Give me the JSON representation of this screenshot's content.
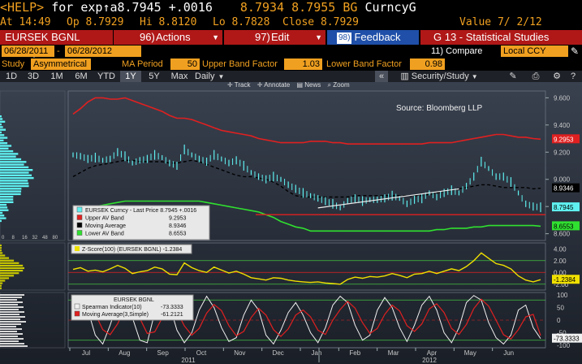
{
  "command": {
    "prompt": "<HELP>",
    "text": " for exp",
    "arrow": "↑",
    "ticker_text": "a8.7945 +.0016",
    "mid": "8.7934 8.7955 BG",
    "ticker": "CurncyG"
  },
  "quote": {
    "at": "At 14:49",
    "op": "Op 8.7929",
    "hi": "Hi 8.8120",
    "lo": "Lo 8.7828",
    "close": "Close 8.7929",
    "value": "Value  7/ 2/12"
  },
  "menu": {
    "security": "EURSEK BGNL Curncy",
    "actions_num": "96)",
    "actions": "Actions",
    "edit_num": "97)",
    "edit": "Edit",
    "feedback_num": "98)",
    "feedback": "Feedback",
    "title": "G 13 - Statistical Studies"
  },
  "range": {
    "start": "06/28/2011",
    "sep": "-",
    "end": "06/28/2012",
    "compare": "11) Compare",
    "currency": "Local CCY"
  },
  "study": {
    "label": "Study",
    "value": "Asymmetrical",
    "ma_label": "MA Period",
    "ma_value": "50",
    "upper_label": "Upper Band Factor",
    "upper_value": "1.03",
    "lower_label": "Lower Band Factor",
    "lower_value": "0.98"
  },
  "tabs": [
    "1D",
    "3D",
    "1M",
    "6M",
    "YTD",
    "1Y",
    "5Y",
    "Max",
    "Daily"
  ],
  "selected_tab": "1Y",
  "toolbar": {
    "collapse": "«",
    "security_study": "Security/Study",
    "track": "Track",
    "annotate": "Annotate",
    "news": "News",
    "zoom": "Zoom"
  },
  "chart_data": [
    {
      "type": "line",
      "title": "",
      "source": "Source: Bloomberg LLP",
      "x_labels": [
        "Jul",
        "Aug",
        "Sep",
        "Oct",
        "Nov",
        "Dec",
        "Jan",
        "Feb",
        "Mar",
        "Apr",
        "May",
        "Jun"
      ],
      "year_labels": [
        "2011",
        "2012"
      ],
      "y_ticks": [
        "9.600",
        "9.400",
        "9.200",
        "9.000",
        "8.800",
        "8.600"
      ],
      "ylim": [
        8.55,
        9.65
      ],
      "last_values": {
        "upper": "9.2953",
        "ma": "8.9346",
        "price": "8.7945",
        "lower": "8.6553"
      },
      "legend": [
        {
          "name": "EURSEK Curncy - Last Price 8.7945  +.0016",
          "color": "#5ff0f0"
        },
        {
          "name": "Upper AV Band",
          "value": "9.2953",
          "color": "#e02020"
        },
        {
          "name": "Moving Average",
          "value": "8.9346",
          "color": "#000000"
        },
        {
          "name": "Lower AV Band",
          "value": "8.6553",
          "color": "#30e030"
        }
      ],
      "histogram_ticks": [
        "0",
        "8",
        "16",
        "32",
        "48",
        "80"
      ],
      "series": [
        {
          "name": "EURSEK Curncy - Last Price",
          "values": [
            9.18,
            9.17,
            9.15,
            9.16,
            9.14,
            9.15,
            9.2,
            9.17,
            9.12,
            9.14,
            9.15,
            9.18,
            9.16,
            9.12,
            9.1,
            9.22,
            9.18,
            9.15,
            9.13,
            9.18,
            9.15,
            9.12,
            9.14,
            9.1,
            9.05,
            9.02,
            9.0,
            9.02,
            9.0,
            8.96,
            8.93,
            8.9,
            8.88,
            8.86,
            8.84,
            8.82,
            8.79,
            8.84,
            8.86,
            8.84,
            8.85,
            8.85,
            8.86,
            8.88,
            8.86,
            8.82,
            8.85,
            8.86,
            8.9,
            8.87,
            8.9,
            8.92,
            8.9,
            8.95,
            9.02,
            9.13,
            9.08,
            9.02,
            9.02,
            8.98,
            8.9,
            8.82,
            8.8,
            8.7945
          ]
        },
        {
          "name": "Upper AV Band",
          "values": [
            9.48,
            9.52,
            9.57,
            9.6,
            9.6,
            9.59,
            9.59,
            9.6,
            9.58,
            9.56,
            9.54,
            9.52,
            9.5,
            9.47,
            9.45,
            9.45,
            9.44,
            9.42,
            9.4,
            9.38,
            9.36,
            9.35,
            9.34,
            9.33,
            9.32,
            9.3,
            9.29,
            9.28,
            9.27,
            9.27,
            9.27,
            9.27,
            9.28,
            9.28,
            9.28,
            9.27,
            9.27,
            9.26,
            9.26,
            9.26,
            9.26,
            9.26,
            9.26,
            9.26,
            9.26,
            9.26,
            9.26,
            9.26,
            9.27,
            9.27,
            9.27,
            9.27,
            9.28,
            9.29,
            9.3,
            9.31,
            9.32,
            9.33,
            9.33,
            9.32,
            9.31,
            9.31,
            9.3,
            9.2953
          ]
        },
        {
          "name": "Moving Average",
          "values": [
            9.02,
            9.05,
            9.08,
            9.1,
            9.11,
            9.12,
            9.13,
            9.14,
            9.14,
            9.13,
            9.13,
            9.13,
            9.13,
            9.12,
            9.12,
            9.13,
            9.14,
            9.13,
            9.11,
            9.09,
            9.07,
            9.05,
            9.03,
            9.02,
            9.02,
            9.01,
            9.0,
            8.98,
            8.95,
            8.91,
            8.88,
            8.87,
            8.87,
            8.87,
            8.87,
            8.87,
            8.87,
            8.87,
            8.88,
            8.88,
            8.88,
            8.88,
            8.88,
            8.88,
            8.88,
            8.88,
            8.88,
            8.88,
            8.89,
            8.9,
            8.91,
            8.92,
            8.93,
            8.94,
            8.95,
            8.96,
            8.96,
            8.95,
            8.94,
            8.94,
            8.94,
            8.94,
            8.93,
            8.9346
          ]
        },
        {
          "name": "Lower AV Band",
          "values": [
            8.78,
            8.79,
            8.8,
            8.8,
            8.81,
            8.82,
            8.83,
            8.84,
            8.84,
            8.84,
            8.84,
            8.84,
            8.84,
            8.84,
            8.84,
            8.84,
            8.84,
            8.84,
            8.83,
            8.82,
            8.81,
            8.8,
            8.79,
            8.78,
            8.77,
            8.76,
            8.74,
            8.72,
            8.69,
            8.67,
            8.65,
            8.64,
            8.62,
            8.62,
            8.62,
            8.62,
            8.62,
            8.62,
            8.62,
            8.62,
            8.62,
            8.62,
            8.62,
            8.62,
            8.62,
            8.62,
            8.62,
            8.62,
            8.62,
            8.63,
            8.63,
            8.64,
            8.64,
            8.64,
            8.65,
            8.65,
            8.66,
            8.66,
            8.66,
            8.66,
            8.66,
            8.66,
            8.66,
            8.6553
          ]
        }
      ],
      "annotations": [
        {
          "type": "hline",
          "y": 8.74,
          "color": "#e02020"
        },
        {
          "type": "trendline",
          "from": [
            33,
            8.79
          ],
          "to": [
            52,
            8.93
          ],
          "color": "#f0f0f0"
        }
      ]
    },
    {
      "type": "line",
      "legend": [
        {
          "name": "Z-Score(100) (EURSEK BGNL)",
          "value": "-1.2384",
          "color": "#f0e000"
        }
      ],
      "y_ticks": [
        "4.00",
        "2.00",
        "0.00",
        "-2.00"
      ],
      "ylim": [
        -3,
        5
      ],
      "last_value": "-1.2384",
      "series": [
        {
          "name": "Z-Score(100) (EURSEK BGNL)",
          "values": [
            0.5,
            0.8,
            0.2,
            0.4,
            0.1,
            0.6,
            1.2,
            0.7,
            -0.2,
            0.1,
            0.3,
            0.9,
            0.6,
            -0.3,
            -0.4,
            1.6,
            0.8,
            0.3,
            0.0,
            0.9,
            0.4,
            -0.1,
            0.2,
            -0.3,
            -0.9,
            -1.1,
            -1.3,
            -0.9,
            -1.0,
            -1.3,
            -1.5,
            -1.6,
            -1.7,
            -1.6,
            -1.8,
            -1.9,
            -2.0,
            -1.2,
            -0.8,
            -1.0,
            -0.7,
            -0.8,
            -0.6,
            -0.2,
            -0.5,
            -0.9,
            -0.3,
            -0.2,
            0.2,
            -0.2,
            0.2,
            0.6,
            0.3,
            1.0,
            2.0,
            3.3,
            2.4,
            1.5,
            1.2,
            0.6,
            -0.6,
            -1.3,
            -1.6,
            -1.2384
          ]
        }
      ]
    },
    {
      "type": "line",
      "legend_title": "EURSEK BGNL",
      "legend": [
        {
          "name": "Spearman Indicator(10)",
          "value": "-73.3333",
          "color": "#f0f0f0"
        },
        {
          "name": "Moving Average(3,Simple)",
          "value": "-61.2121",
          "color": "#e02020"
        }
      ],
      "y_ticks": [
        "100",
        "50",
        "0",
        "-50",
        "-100"
      ],
      "ylim": [
        -110,
        110
      ],
      "last_value": "-73.3333",
      "series": [
        {
          "name": "Spearman Indicator(10)",
          "values": [
            60,
            95,
            40,
            -60,
            -95,
            -20,
            70,
            90,
            10,
            -80,
            -90,
            30,
            85,
            60,
            -40,
            -90,
            -50,
            40,
            95,
            50,
            -30,
            -85,
            -70,
            20,
            80,
            40,
            -60,
            -95,
            -40,
            30,
            70,
            20,
            -50,
            -90,
            -30,
            60,
            95,
            70,
            -20,
            -80,
            -60,
            40,
            90,
            50,
            -30,
            -85,
            -20,
            60,
            95,
            40,
            -50,
            -90,
            -30,
            70,
            98,
            80,
            -10,
            -70,
            -95,
            -60,
            40,
            60,
            -30,
            -73.33
          ]
        },
        {
          "name": "Moving Average(3,Simple)",
          "values": [
            40,
            70,
            65,
            25,
            -38,
            -58,
            -15,
            47,
            57,
            7,
            -53,
            -47,
            8,
            58,
            35,
            -23,
            -60,
            -33,
            28,
            62,
            38,
            -22,
            -62,
            -45,
            10,
            47,
            20,
            -38,
            -65,
            -35,
            20,
            40,
            13,
            -40,
            -57,
            0,
            42,
            75,
            48,
            -10,
            -53,
            -33,
            23,
            60,
            37,
            -22,
            -45,
            -15,
            45,
            65,
            30,
            -33,
            -57,
            -17,
            46,
            83,
            56,
            0,
            -58,
            -75,
            -38,
            13,
            23,
            -61.21
          ]
        }
      ]
    }
  ]
}
